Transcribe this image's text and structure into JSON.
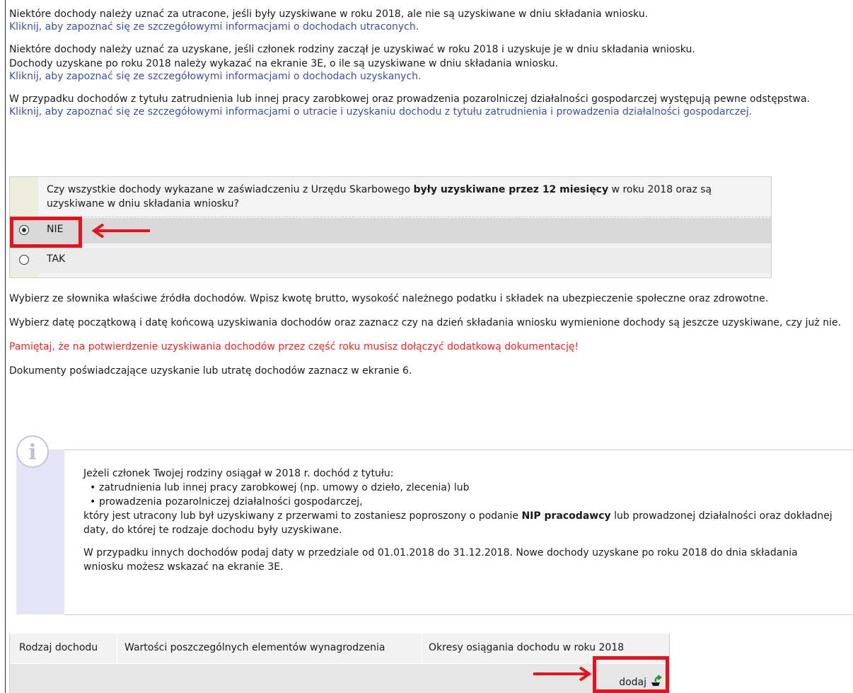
{
  "intro": {
    "p1_text": "Niektóre dochody należy uznać za utracone, jeśli były uzyskiwane w roku 2018, ale nie są uzyskiwane w dniu składania wniosku.",
    "p1_link": "Kliknij, aby zapoznać się ze szczegółowymi informacjami o dochodach utraconych.",
    "p2_line1": "Niektóre dochody należy uznać za uzyskane, jeśli członek rodziny zaczął je uzyskiwać w roku 2018 i uzyskuje je w dniu składania wniosku.",
    "p2_line2": "Dochody uzyskane po roku 2018 należy wykazać na ekranie 3E, o ile są uzyskiwane w dniu składania wniosku.",
    "p2_link": "Kliknij, aby zapoznać się ze szczegółowymi informacjami o dochodach uzyskanych.",
    "p3_text": "W przypadku dochodów z tytułu zatrudnienia lub innej pracy zarobkowej oraz prowadzenia pozarolniczej działalności gospodarczej występują pewne odstępstwa.",
    "p3_link": "Kliknij, aby zapoznać się ze szczegółowymi informacjami o utracie i uzyskaniu dochodu z tytułu zatrudnienia i prowadzenia działalności gospodarczej."
  },
  "question": {
    "text_before": "Czy wszystkie dochody wykazane w zaświadczeniu z Urzędu Skarbowego ",
    "text_bold": "były uzyskiwane przez 12 miesięcy",
    "text_after": " w roku 2018 oraz są uzyskiwane w dniu składania wniosku?",
    "options": [
      {
        "label": "NIE",
        "selected": true
      },
      {
        "label": "TAK",
        "selected": false
      }
    ]
  },
  "instructions": {
    "i1": "Wybierz ze słownika właściwe źródła dochodów. Wpisz kwotę brutto, wysokość należnego podatku i składek na ubezpieczenie społeczne oraz zdrowotne.",
    "i2": "Wybierz datę początkową i datę końcową uzyskiwania dochodów oraz zaznacz czy na dzień składania wniosku wymienione dochody są jeszcze uzyskiwane, czy już nie.",
    "warning": "Pamiętaj, że na potwierdzenie uzyskiwania dochodów przez część roku musisz dołączyć dodatkową dokumentację!",
    "i3": "Dokumenty poświadczające uzyskanie lub utratę dochodów zaznacz w ekranie 6."
  },
  "info": {
    "icon": "info-icon",
    "lead": "Jeżeli członek Twojej rodziny osiągał w 2018 r. dochód z tytułu:",
    "bullets": [
      "zatrudnienia lub innej pracy zarobkowej (np. umowy o dzieło, zlecenia) lub",
      "prowadzenia pozarolniczej działalności gospodarczej,"
    ],
    "para_before": "który jest utracony lub był uzyskiwany z przerwami to zostaniesz poproszony o podanie ",
    "para_bold": "NIP pracodawcy",
    "para_after": " lub prowadzonej działalności oraz dokładnej daty, do której te rodzaje dochodu były uzyskiwane.",
    "para2": "W przypadku innych dochodów podaj daty w przedziale od 01.01.2018 do 31.12.2018. Nowe dochody uzyskane po roku 2018 do dnia składania wniosku możesz wskazać na ekranie 3E."
  },
  "table": {
    "headers": [
      "Rodzaj dochodu",
      "Wartości poszczególnych elementów wynagrodzenia",
      "Okresy osiągania dochodu w roku 2018"
    ],
    "add_label": "dodaj"
  },
  "colors": {
    "link": "#3a4fae",
    "warning": "#ff2020",
    "highlight": "#e8121c"
  }
}
